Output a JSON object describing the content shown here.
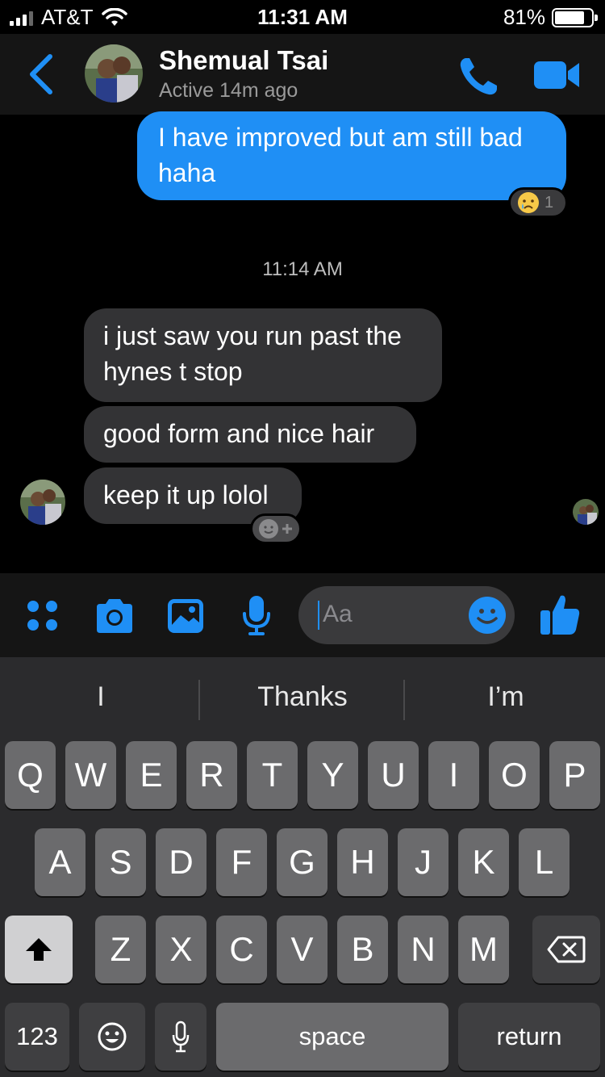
{
  "status_bar": {
    "carrier": "AT&T",
    "time": "11:31 AM",
    "battery": "81%",
    "battery_level": 0.81
  },
  "header": {
    "contact_name": "Shemual Tsai",
    "status": "Active 14m ago"
  },
  "messages": {
    "outgoing_1": "I have improved but am still bad haha",
    "reaction_count": "1",
    "timestamp": "11:14 AM",
    "incoming": [
      "i just saw you run past the hynes t stop",
      "good form and nice hair",
      "keep it up lolol"
    ]
  },
  "composer": {
    "placeholder": "Aa"
  },
  "keyboard": {
    "suggestions": [
      "I",
      "Thanks",
      "I’m"
    ],
    "row1": [
      "Q",
      "W",
      "E",
      "R",
      "T",
      "Y",
      "U",
      "I",
      "O",
      "P"
    ],
    "row2": [
      "A",
      "S",
      "D",
      "F",
      "G",
      "H",
      "J",
      "K",
      "L"
    ],
    "row3": [
      "Z",
      "X",
      "C",
      "V",
      "B",
      "N",
      "M"
    ],
    "numbers_label": "123",
    "space_label": "space",
    "return_label": "return"
  },
  "colors": {
    "accent": "#1f8ff5",
    "incoming_bubble": "#333335",
    "background": "#000000"
  }
}
